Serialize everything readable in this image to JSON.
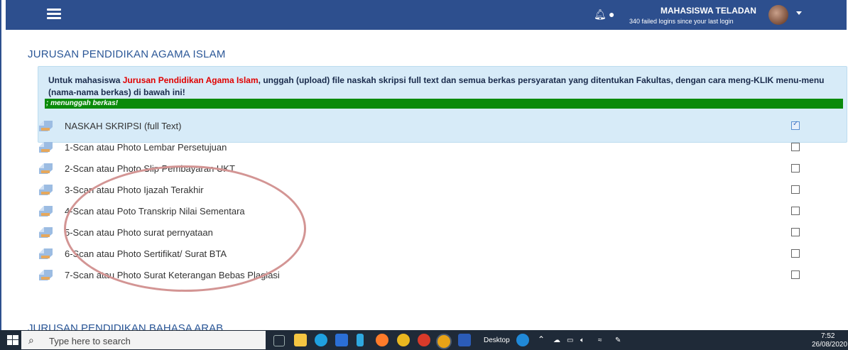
{
  "navbar": {
    "user_name": "MAHASISWA TELADAN",
    "login_notice": "340 failed logins since your last login"
  },
  "section": {
    "title": "JURUSAN PENDIDIKAN AGAMA ISLAM",
    "info_prefix": "Untuk mahasiswa ",
    "info_highlight": "Jurusan Pendidikan Agama Islam",
    "info_suffix": ", unggah (upload) file naskah skripsi full text dan semua berkas persyaratan yang ditentukan Fakultas, dengan cara meng-KLIK menu-menu (nama-nama berkas) di bawah ini!",
    "marquee_text": "; menunggah berkas!"
  },
  "files": [
    {
      "label": "NASKAH SKRIPSI (full Text)",
      "checked": true
    },
    {
      "label": "1-Scan atau Photo Lembar Persetujuan",
      "checked": false
    },
    {
      "label": "2-Scan atau Photo Slip Pembayaran UKT",
      "checked": false
    },
    {
      "label": "3-Scan atau Photo Ijazah Terakhir",
      "checked": false
    },
    {
      "label": "4-Scan atau Poto Transkrip Nilai Sementara",
      "checked": false
    },
    {
      "label": "5-Scan atau Photo surat pernyataan",
      "checked": false
    },
    {
      "label": "6-Scan atau Photo Sertifikat/ Surat BTA",
      "checked": false
    },
    {
      "label": "7-Scan atau Photo Surat Keterangan Bebas Plagiasi",
      "checked": false
    }
  ],
  "next_section": {
    "title": "JURUSAN PENDIDIKAN BAHASA ARAB"
  },
  "taskbar": {
    "search_placeholder": "Type here to search",
    "desktop_label": "Desktop",
    "time": "7:52",
    "date": "26/08/2020"
  },
  "colors": {
    "navbar": "#2d4f8e",
    "info_box": "#d7ebf8",
    "marquee_bar": "#0a8a0a",
    "highlight": "#e00000",
    "annotation": "#d39594"
  }
}
